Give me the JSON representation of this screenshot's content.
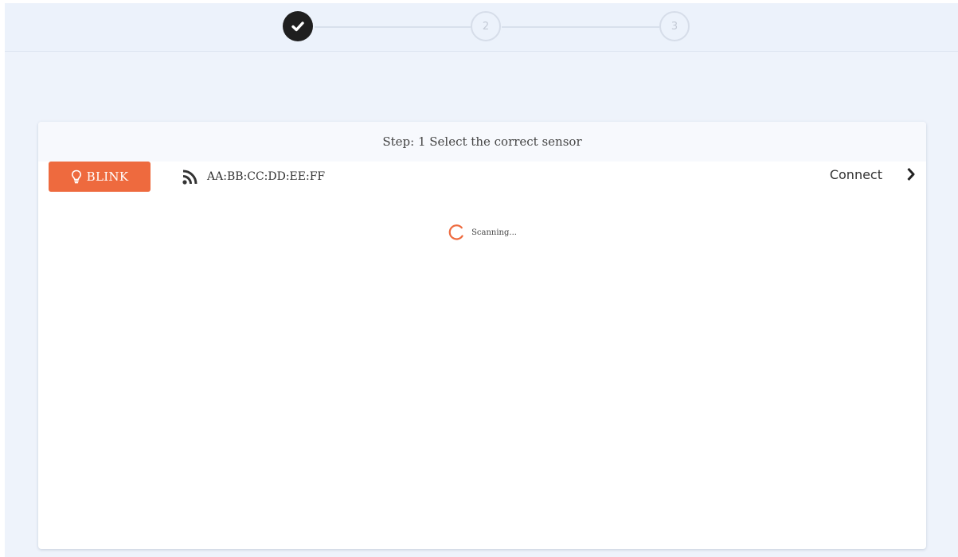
{
  "stepper": {
    "steps": [
      {
        "label": "",
        "state": "complete",
        "icon": "check-icon"
      },
      {
        "label": "2",
        "state": "pending"
      },
      {
        "label": "3",
        "state": "pending"
      }
    ]
  },
  "card": {
    "title": "Step: 1 Select the correct sensor",
    "device": {
      "blink_label": "BLINK",
      "blink_icon": "lightbulb-icon",
      "signal_icon": "rss-icon",
      "mac_address": "AA:BB:CC:DD:EE:FF",
      "connect_label": "Connect",
      "connect_icon": "chevron-right-icon"
    },
    "scanning": {
      "text": "Scanning...",
      "icon": "spinner-icon"
    }
  },
  "colors": {
    "accent": "#ee6a3e",
    "background": "#eef3fb",
    "step_complete": "#1f1f1f",
    "step_pending": "#d6dde9"
  }
}
